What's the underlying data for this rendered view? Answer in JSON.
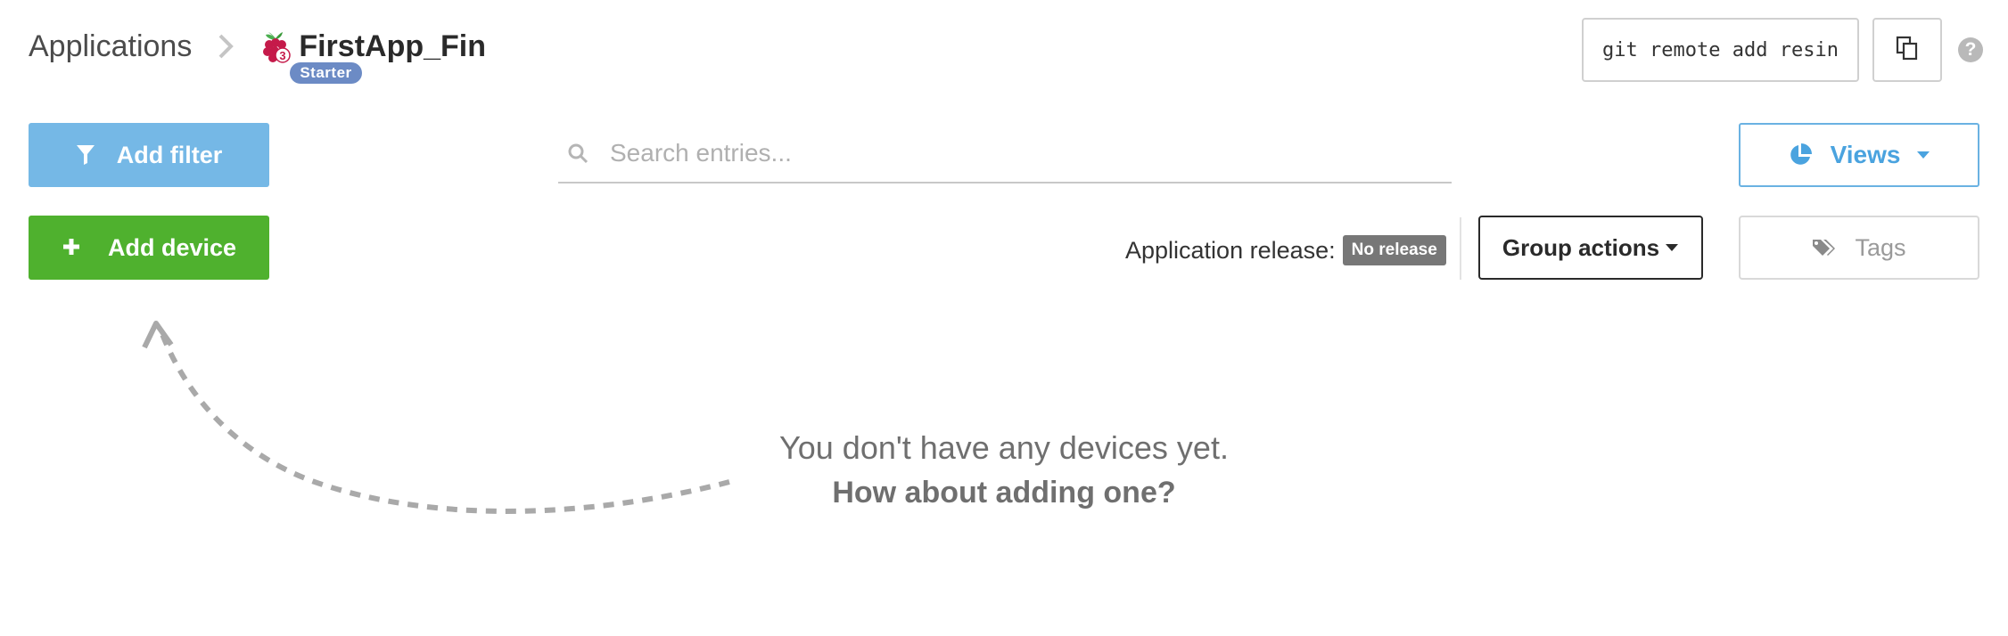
{
  "breadcrumb": {
    "root": "Applications",
    "app_name": "FirstApp_Fin",
    "plan_badge": "Starter",
    "device_type_badge": "3"
  },
  "header": {
    "git_command": "git remote add resin",
    "help_symbol": "?"
  },
  "toolbar": {
    "add_filter_label": "Add filter",
    "search_placeholder": "Search entries...",
    "views_label": "Views",
    "add_device_label": "Add device",
    "release_label": "Application release:",
    "release_value": "No release",
    "group_actions_label": "Group actions",
    "tags_label": "Tags"
  },
  "empty_state": {
    "line1": "You don't have any devices yet.",
    "line2": "How about adding one?"
  },
  "colors": {
    "add_filter_bg": "#75b8e6",
    "add_device_bg": "#4fb12e",
    "views_accent": "#4aa3df",
    "plan_badge_bg": "#6c8bc5",
    "release_badge_bg": "#777777"
  },
  "icons": [
    "chevron-right-icon",
    "raspberry-pi-icon",
    "copy-icon",
    "help-icon",
    "filter-icon",
    "search-icon",
    "pie-chart-icon",
    "caret-down-icon",
    "plus-icon",
    "tag-icon",
    "dashed-arrow-icon"
  ]
}
